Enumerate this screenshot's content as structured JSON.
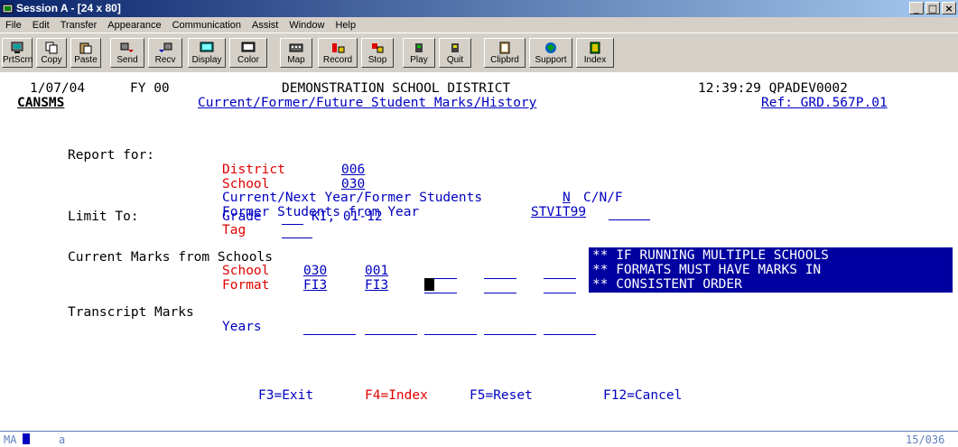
{
  "window": {
    "title": "Session A - [24 x 80]",
    "buttons": [
      "_",
      "□",
      "×"
    ]
  },
  "menu": [
    "File",
    "Edit",
    "Transfer",
    "Appearance",
    "Communication",
    "Assist",
    "Window",
    "Help"
  ],
  "toolbar": [
    {
      "label": "PrtScrn",
      "icon": "printer-screen-icon"
    },
    {
      "label": "Copy",
      "icon": "copy-icon"
    },
    {
      "label": "Paste",
      "icon": "paste-icon"
    },
    {
      "label": "Send",
      "icon": "send-icon"
    },
    {
      "label": "Recv",
      "icon": "receive-icon"
    },
    {
      "label": "Display",
      "icon": "display-icon"
    },
    {
      "label": "Color",
      "icon": "color-icon"
    },
    {
      "label": "Map",
      "icon": "map-icon"
    },
    {
      "label": "Record",
      "icon": "record-icon"
    },
    {
      "label": "Stop",
      "icon": "stop-icon"
    },
    {
      "label": "Play",
      "icon": "play-icon"
    },
    {
      "label": "Quit",
      "icon": "quit-icon"
    },
    {
      "label": "Clipbrd",
      "icon": "clipboard-icon"
    },
    {
      "label": "Support",
      "icon": "support-icon"
    },
    {
      "label": "Index",
      "icon": "index-icon"
    }
  ],
  "screen": {
    "date": "1/07/04",
    "fy": "FY 00",
    "district_name": "DEMONSTRATION SCHOOL DISTRICT",
    "time_pgm": "12:39:29 QPADEV0002",
    "program": "CANSMS",
    "screen_title": "Current/Former/Future Student Marks/History",
    "ref": "Ref: GRD.567P.01",
    "report_for_label": "Report for:",
    "district_label": "District",
    "district_value": "006",
    "school_label": "School",
    "school_value": "030",
    "students_label": "Current/Next Year/Former Students",
    "students_value": "N",
    "students_opts": "C/N/F",
    "former_label": "Former Students from Year",
    "former_value": "STVIT99",
    "limit_label": "Limit To:",
    "grade_label": "Grade",
    "grade_value": "",
    "grade_hint": "KI, 01-12",
    "tag_label": "Tag",
    "tag_value": "",
    "current_marks_label": "Current Marks from Schools",
    "cm_school_label": "School",
    "cm_schools": [
      "030",
      "001",
      "",
      "",
      ""
    ],
    "cm_format_label": "Format",
    "cm_formats": [
      "FI3",
      "FI3",
      "",
      "",
      ""
    ],
    "warning": [
      "** IF RUNNING MULTIPLE SCHOOLS",
      "** FORMATS MUST HAVE MARKS IN",
      "** CONSISTENT ORDER"
    ],
    "transcript_label": "Transcript Marks",
    "years_label": "Years",
    "years": [
      "",
      "",
      "",
      "",
      ""
    ],
    "fkeys": {
      "f3": "F3=Exit",
      "f4": "F4=Index",
      "f5": "F5=Reset",
      "f12": "F12=Cancel"
    }
  },
  "status_bar": {
    "mode": "MA",
    "indicator": "a",
    "cursor_pos": "15/036"
  },
  "colors": {
    "field_blue": "#0000c0",
    "label_red": "#e00000",
    "warning_bg": "#0000a0"
  }
}
